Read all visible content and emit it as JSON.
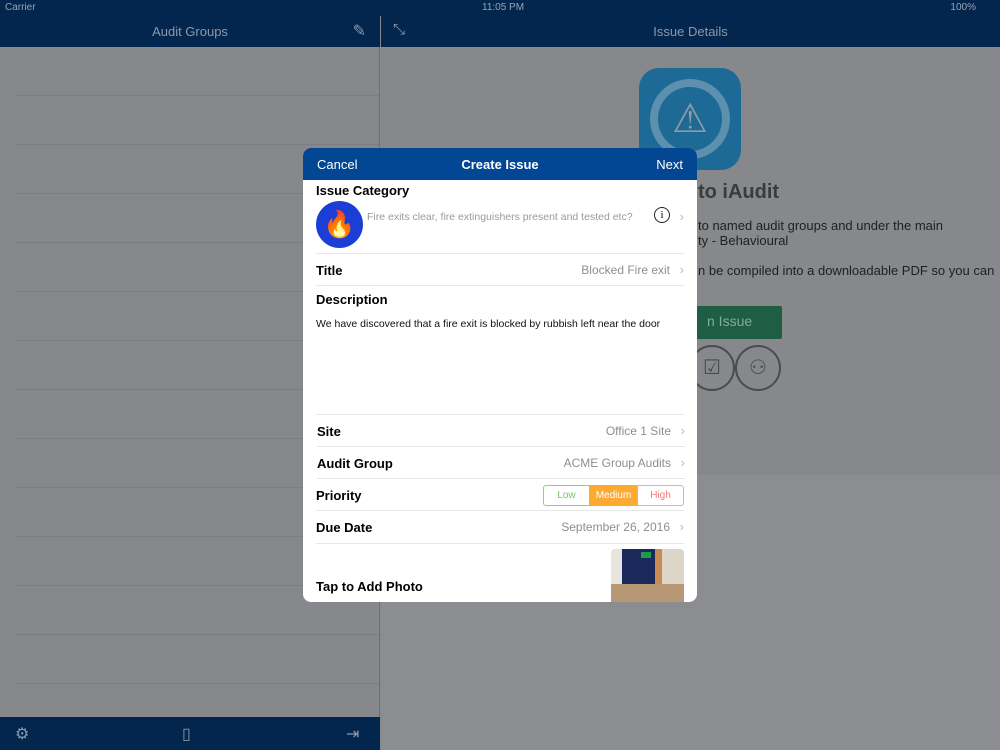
{
  "status": {
    "carrier": "Carrier",
    "time": "11:05 PM",
    "battery": "100%"
  },
  "left": {
    "title": "Audit Groups"
  },
  "right": {
    "title": "Issue Details",
    "welcome": "to iAudit",
    "text1": "to named audit groups and under the main",
    "text2": "ty - Behavioural",
    "text3": "n be compiled into a downloadable PDF so you can",
    "button": "n Issue"
  },
  "modal": {
    "cancel": "Cancel",
    "title": "Create Issue",
    "next": "Next",
    "category_label": "Issue Category",
    "category_text": "Fire exits clear, fire extinguishers present and tested etc?",
    "title_label": "Title",
    "title_value": "Blocked Fire exit",
    "description_label": "Description",
    "description_value": "We have discovered that a fire exit is blocked by rubbish left near the door",
    "site_label": "Site",
    "site_value": "Office 1 Site",
    "group_label": "Audit Group",
    "group_value": "ACME Group Audits",
    "priority_label": "Priority",
    "priority_options": [
      "Low",
      "Medium",
      "High"
    ],
    "priority_selected": "Medium",
    "due_label": "Due Date",
    "due_value": "September 26, 2016",
    "photo_label": "Tap to Add Photo"
  },
  "colors": {
    "nav": "#034693",
    "medium": "#fdaa32",
    "low": "#7ac46a",
    "high": "#f27d73"
  }
}
